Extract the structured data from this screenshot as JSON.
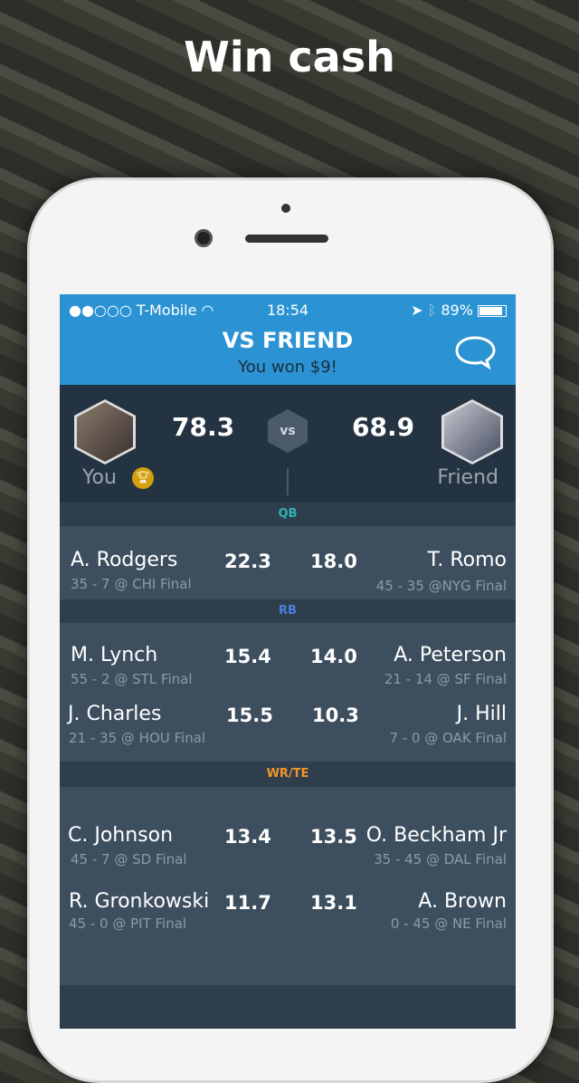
{
  "headline": "Win cash",
  "status": {
    "carrier": "●●○○○ T-Mobile",
    "time": "18:54",
    "battery": "89%",
    "battery_level": 0.89
  },
  "header": {
    "title": "VS FRIEND",
    "subtitle": "You won $9!"
  },
  "score": {
    "you_label": "You",
    "friend_label": "Friend",
    "you_score": "78.3",
    "friend_score": "68.9",
    "vs": "vs"
  },
  "sections": [
    {
      "label": "QB",
      "color": "#2bb3b0",
      "rows": [
        {
          "left_name": "A. Rodgers",
          "left_game": "35 - 7 @ CHI Final",
          "left_score": "22.3",
          "right_score": "18.0",
          "right_name": "T. Romo",
          "right_game": "45 - 35 @NYG Final"
        }
      ]
    },
    {
      "label": "RB",
      "color": "#4a7fe0",
      "rows": [
        {
          "left_name": "M. Lynch",
          "left_game": "55 - 2 @ STL Final",
          "left_score": "15.4",
          "right_score": "14.0",
          "right_name": "A. Peterson",
          "right_game": "21 - 14 @ SF Final"
        },
        {
          "left_name": "J. Charles",
          "left_game": "21 - 35 @ HOU Final",
          "left_score": "15.5",
          "right_score": "10.3",
          "right_name": "J. Hill",
          "right_game": "7 - 0 @ OAK Final"
        }
      ]
    },
    {
      "label": "WR/TE",
      "color": "#f0952e",
      "rows": [
        {
          "left_name": "C. Johnson",
          "left_game": "45 - 7 @ SD Final",
          "left_score": "13.4",
          "right_score": "13.5",
          "right_name": "O. Beckham Jr",
          "right_game": "35 - 45 @ DAL Final"
        },
        {
          "left_name": "R. Gronkowski",
          "left_game": "45 - 0 @ PIT Final",
          "left_score": "11.7",
          "right_score": "13.1",
          "right_name": "A. Brown",
          "right_game": "0 - 45 @ NE Final"
        }
      ]
    }
  ]
}
